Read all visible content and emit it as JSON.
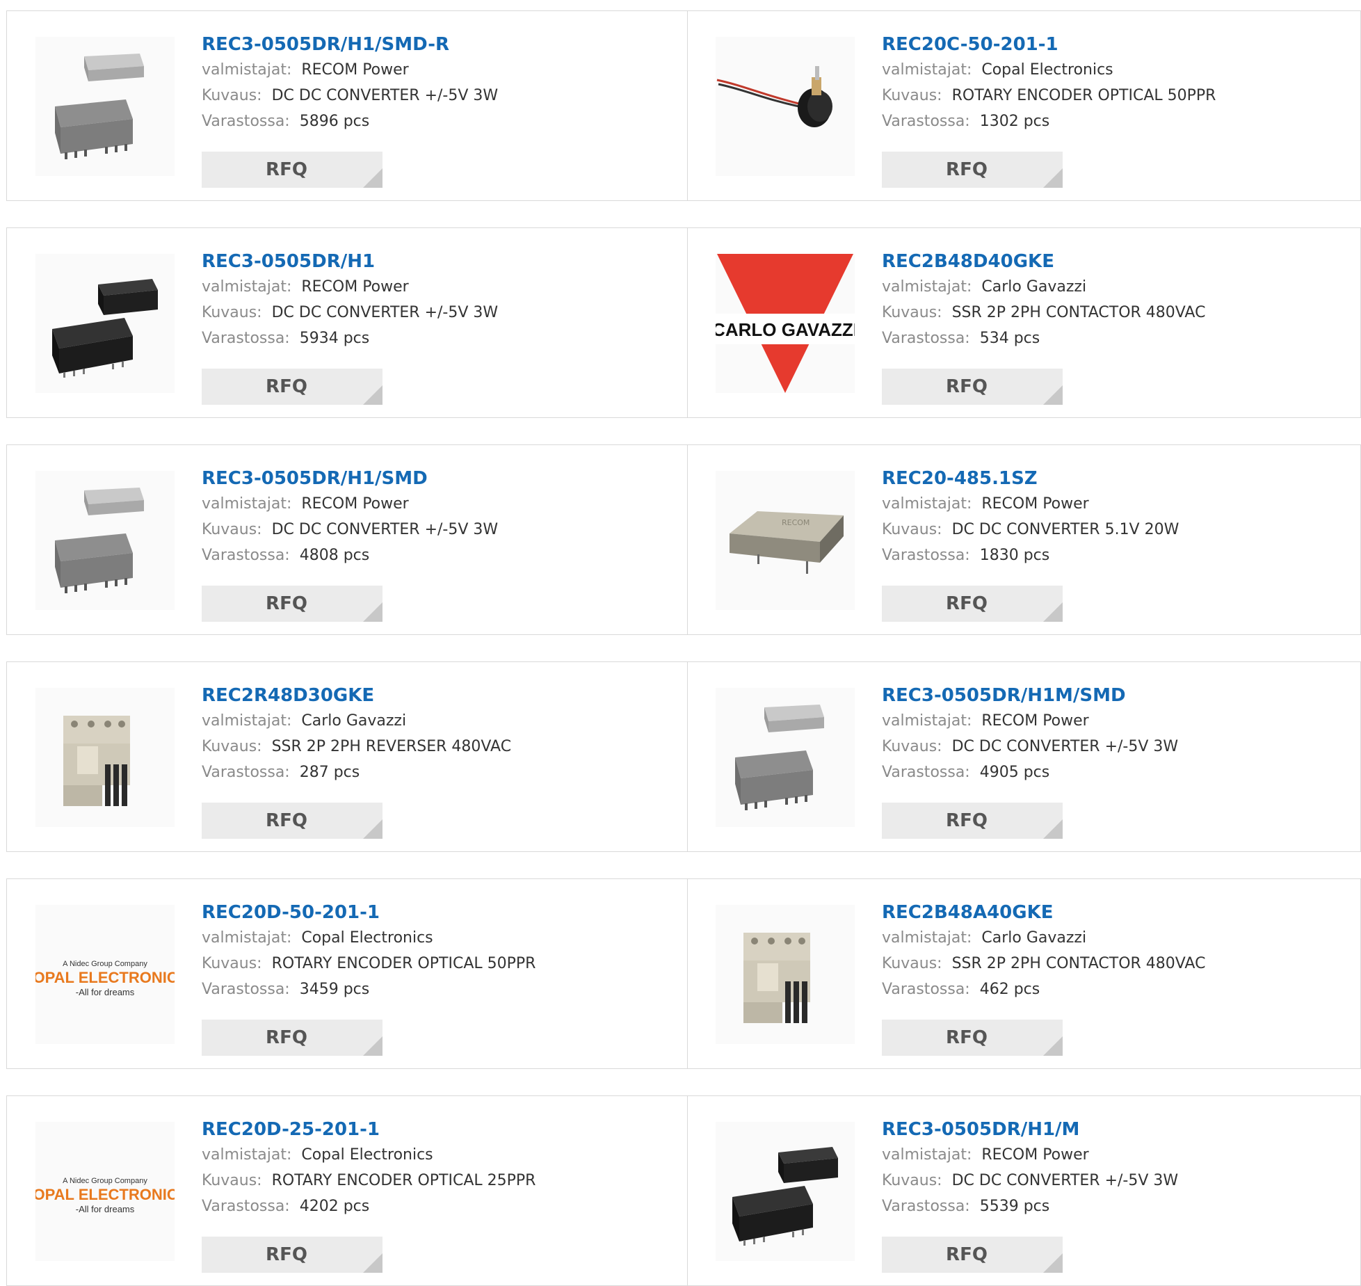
{
  "labels": {
    "manufacturer": "valmistajat:",
    "description": "Kuvaus:",
    "stock": "Varastossa:",
    "rfq": "RFQ"
  },
  "products": [
    {
      "part": "REC3-0505DR/H1/SMD-R",
      "manufacturer": "RECOM Power",
      "description": "DC DC CONVERTER +/-5V 3W",
      "stock": "5896 pcs",
      "image": "module-silver-pair-icon"
    },
    {
      "part": "REC20C-50-201-1",
      "manufacturer": "Copal Electronics",
      "description": "ROTARY ENCODER OPTICAL 50PPR",
      "stock": "1302 pcs",
      "image": "rotary-encoder-icon"
    },
    {
      "part": "REC3-0505DR/H1",
      "manufacturer": "RECOM Power",
      "description": "DC DC CONVERTER +/-5V 3W",
      "stock": "5934 pcs",
      "image": "module-black-pair-icon"
    },
    {
      "part": "REC2B48D40GKE",
      "manufacturer": "Carlo Gavazzi",
      "description": "SSR 2P 2PH CONTACTOR 480VAC",
      "stock": "534 pcs",
      "image": "carlo-gavazzi-logo",
      "logo_text": "CARLO GAVAZZI"
    },
    {
      "part": "REC3-0505DR/H1/SMD",
      "manufacturer": "RECOM Power",
      "description": "DC DC CONVERTER +/-5V 3W",
      "stock": "4808 pcs",
      "image": "module-silver-pair-icon"
    },
    {
      "part": "REC20-485.1SZ",
      "manufacturer": "RECOM Power",
      "description": "DC DC CONVERTER 5.1V 20W",
      "stock": "1830 pcs",
      "image": "module-metal-can-icon"
    },
    {
      "part": "REC2R48D30GKE",
      "manufacturer": "Carlo Gavazzi",
      "description": "SSR 2P 2PH REVERSER 480VAC",
      "stock": "287 pcs",
      "image": "contactor-relay-icon"
    },
    {
      "part": "REC3-0505DR/H1M/SMD",
      "manufacturer": "RECOM Power",
      "description": "DC DC CONVERTER +/-5V 3W",
      "stock": "4905 pcs",
      "image": "module-silver-pair-icon"
    },
    {
      "part": "REC20D-50-201-1",
      "manufacturer": "Copal Electronics",
      "description": "ROTARY ENCODER OPTICAL 50PPR",
      "stock": "3459 pcs",
      "image": "copal-electronics-logo",
      "logo_lines": [
        "A Nidec Group Company",
        "COPAL ELECTRONICS",
        "-All for dreams"
      ]
    },
    {
      "part": "REC2B48A40GKE",
      "manufacturer": "Carlo Gavazzi",
      "description": "SSR 2P 2PH CONTACTOR 480VAC",
      "stock": "462 pcs",
      "image": "contactor-relay-icon"
    },
    {
      "part": "REC20D-25-201-1",
      "manufacturer": "Copal Electronics",
      "description": "ROTARY ENCODER OPTICAL 25PPR",
      "stock": "4202 pcs",
      "image": "copal-electronics-logo",
      "logo_lines": [
        "A Nidec Group Company",
        "COPAL ELECTRONICS",
        "-All for dreams"
      ]
    },
    {
      "part": "REC3-0505DR/H1/M",
      "manufacturer": "RECOM Power",
      "description": "DC DC CONVERTER +/-5V 3W",
      "stock": "5539 pcs",
      "image": "module-black-pair-icon"
    }
  ],
  "colors": {
    "link": "#1469b4",
    "label": "#8a8a8a",
    "button_bg": "#ebebeb",
    "border": "#d9d9d9",
    "gavazzi_red": "#e63a2e",
    "copal_orange": "#e8791e"
  }
}
